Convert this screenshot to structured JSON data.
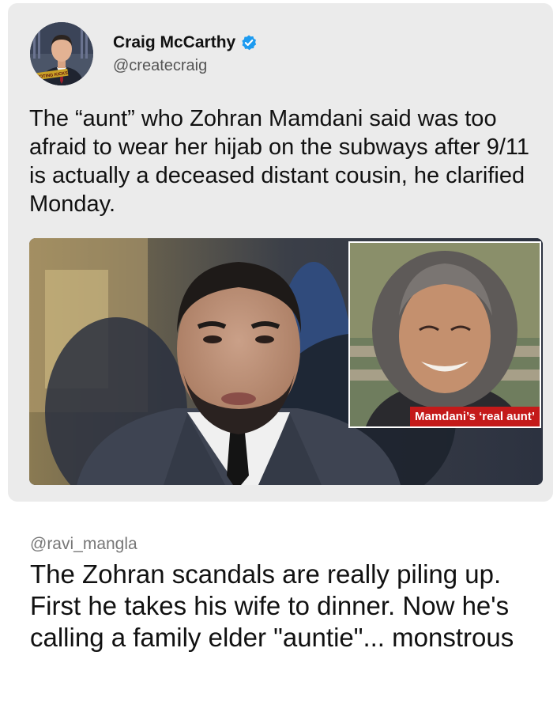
{
  "tweet": {
    "author_name": "Craig McCarthy",
    "author_handle": "@createcraig",
    "avatar_banner_text": "Y VOTING KICKS",
    "text": "The “aunt” who Zohran Mamdani said was too afraid to wear her hijab on the subways after 9/11 is actually a deceased distant cousin, he clarified Monday.",
    "media": {
      "inset_caption": "Mamdani’s ‘real aunt’"
    },
    "verified_icon": "verified-badge-icon",
    "verified_color": "#1d9bf0"
  },
  "reply": {
    "handle": "@ravi_mangla",
    "text": "The Zohran scandals are really piling up. First he takes his wife to dinner. Now he's calling a family elder \"auntie\"... monstrous"
  }
}
